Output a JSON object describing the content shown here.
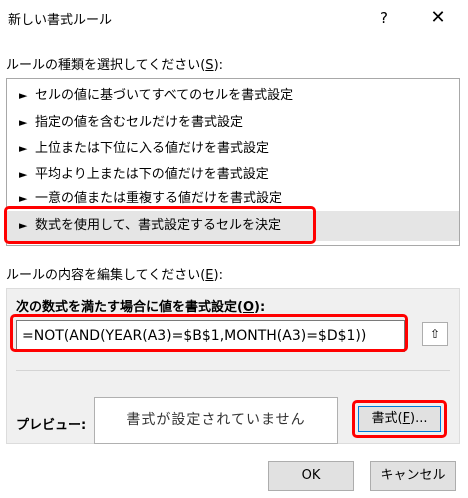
{
  "window": {
    "title": "新しい書式ルール",
    "help_label": "?",
    "close_label": "✕"
  },
  "rule_type": {
    "label_prefix": "ルールの種類を選択してください(",
    "label_key": "S",
    "label_suffix": "):",
    "items": [
      {
        "label": "セルの値に基づいてすべてのセルを書式設定",
        "arrow": "►"
      },
      {
        "label": "指定の値を含むセルだけを書式設定",
        "arrow": "►"
      },
      {
        "label": "上位または下位に入る値だけを書式設定",
        "arrow": "►"
      },
      {
        "label": "平均より上または下の値だけを書式設定",
        "arrow": "►"
      },
      {
        "label": "一意の値または重複する値だけを書式設定",
        "arrow": "►"
      },
      {
        "label": "数式を使用して、書式設定するセルを決定",
        "arrow": "►"
      }
    ],
    "selected_index": 5
  },
  "edit": {
    "label_prefix": "ルールの内容を編集してください(",
    "label_key": "E",
    "label_suffix": "):",
    "formula_label_prefix": "次の数式を満たす場合に値を書式設定(",
    "formula_label_key": "O",
    "formula_label_suffix": "):",
    "formula_value": "=NOT(AND(YEAR(A3)=$B$1,MONTH(A3)=$D$1))",
    "collapse_icon": "⇧",
    "preview_label": "プレビュー:",
    "preview_text": "書式が設定されていません",
    "format_prefix": "書式(",
    "format_key": "F",
    "format_suffix": ")..."
  },
  "buttons": {
    "ok_label": "OK",
    "cancel_label": "キャンセル"
  },
  "colors": {
    "highlight": "#ff0000",
    "selected_row": "#e5e5e5",
    "focus_border": "#0078d7"
  }
}
